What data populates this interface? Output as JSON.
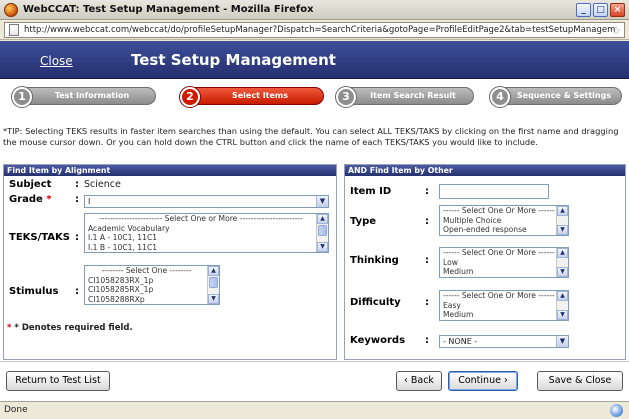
{
  "window": {
    "title": "WebCCAT: Test Setup Management - Mozilla Firefox",
    "minimize_icon": "minimize-icon",
    "maximize_icon": "maximize-icon",
    "close_icon": "close-icon"
  },
  "address_bar": {
    "url": "http://www.webccat.com/webccat/do/profileSetupManager?Dispatch=SearchCriteria&gotoPage=ProfileEditPage2&tab=testSetupManagem"
  },
  "header": {
    "close_link": "Close",
    "title": "Test Setup Management"
  },
  "steps": [
    {
      "num": "1",
      "label": "Test Information",
      "active": false
    },
    {
      "num": "2",
      "label": "Select Items",
      "active": true
    },
    {
      "num": "3",
      "label": "Item Search Result",
      "active": false
    },
    {
      "num": "4",
      "label": "Sequence & Settings",
      "active": false
    }
  ],
  "tip": "*TIP: Selecting TEKS results in faster item searches than using the default. You can select ALL TEKS/TAKS by clicking on the first name and dragging the mouse cursor down. Or you can hold down the CTRL button and click the name of each TEKS/TAKS you would like to include.",
  "left_panel": {
    "header": "Find Item by Alignment",
    "subject_label": "Subject",
    "subject_value": "Science",
    "grade_label": "Grade",
    "grade_required": "*",
    "grade_value": "I",
    "teks_label": "TEKS/TAKS",
    "teks_options": [
      "----------------------- Select One or More -----------------------",
      "Academic Vocabulary",
      "I.1 A - 10C1, 11C1",
      "I.1 B - 10C1, 11C1"
    ],
    "stimulus_label": "Stimulus",
    "stimulus_options": [
      "-------- Select One --------",
      "CI1058283RX_1p",
      "CI1058285RX_1p",
      "CI1058288RXp"
    ],
    "required_note": "* Denotes required field."
  },
  "right_panel": {
    "header": "AND Find Item by Other",
    "item_id_label": "Item ID",
    "item_id_value": "",
    "type_label": "Type",
    "type_options": [
      "------ Select One Or More ------",
      "Multiple Choice",
      "Open-ended response"
    ],
    "thinking_label": "Thinking",
    "thinking_options": [
      "------ Select One Or More ------",
      "Low",
      "Medium"
    ],
    "difficulty_label": "Difficulty",
    "difficulty_options": [
      "------ Select One Or More ------",
      "Easy",
      "Medium"
    ],
    "keywords_label": "Keywords",
    "keywords_value": "- NONE -"
  },
  "buttons": {
    "return": "Return to Test List",
    "back": "‹ Back",
    "continue": "Continue ›",
    "save_close": "Save & Close"
  },
  "status": {
    "text": "Done"
  },
  "colon": ":"
}
